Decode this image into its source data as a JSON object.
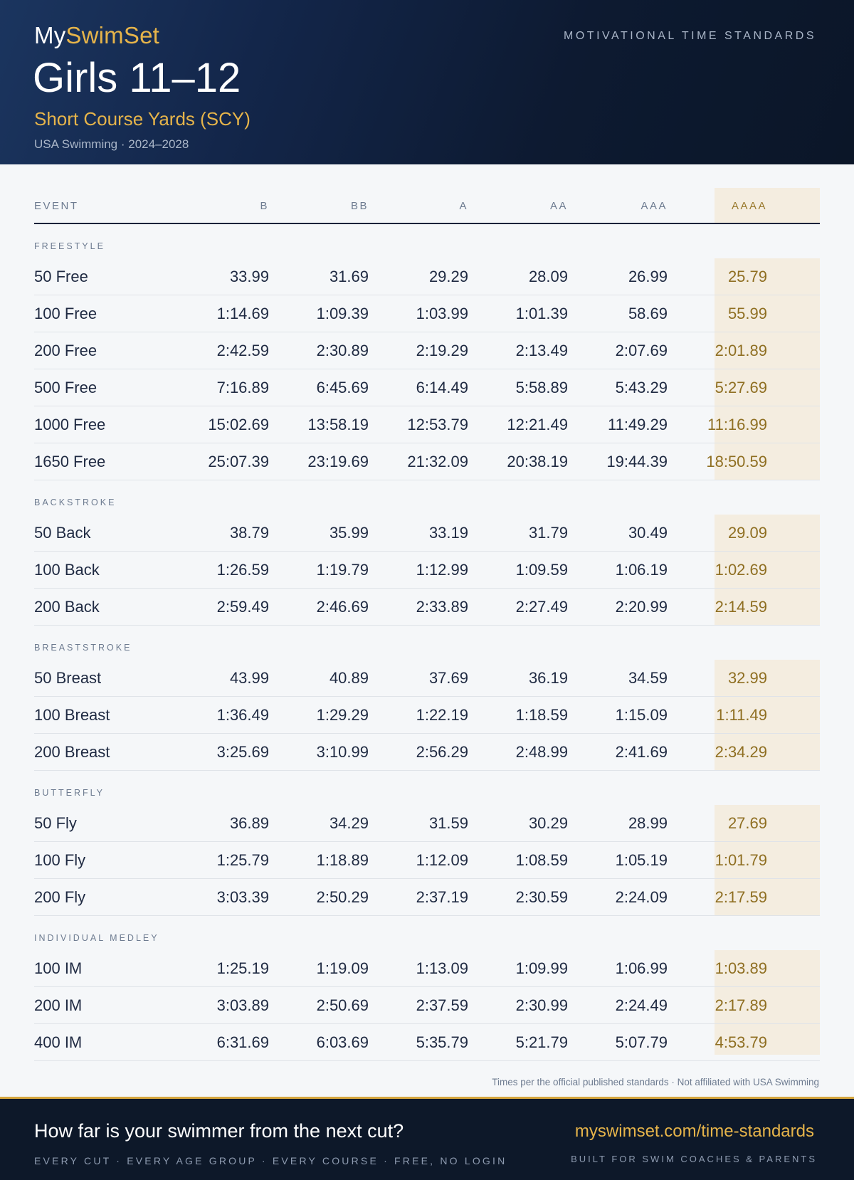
{
  "header": {
    "brand_prefix": "My",
    "brand_accent": "SwimSet",
    "kicker": "MOTIVATIONAL TIME STANDARDS",
    "title": "Girls 11–12",
    "subtitle": "Short Course Yards (SCY)",
    "meta": "USA Swimming · 2024–2028"
  },
  "table": {
    "columns": [
      "EVENT",
      "B",
      "BB",
      "A",
      "AA",
      "AAA",
      "AAAA"
    ],
    "highlight_color": "#f4ede0",
    "sections": [
      {
        "name": "FREESTYLE",
        "rows": [
          {
            "event": "50 Free",
            "times": [
              "33.99",
              "31.69",
              "29.29",
              "28.09",
              "26.99",
              "25.79"
            ]
          },
          {
            "event": "100 Free",
            "times": [
              "1:14.69",
              "1:09.39",
              "1:03.99",
              "1:01.39",
              "58.69",
              "55.99"
            ]
          },
          {
            "event": "200 Free",
            "times": [
              "2:42.59",
              "2:30.89",
              "2:19.29",
              "2:13.49",
              "2:07.69",
              "2:01.89"
            ]
          },
          {
            "event": "500 Free",
            "times": [
              "7:16.89",
              "6:45.69",
              "6:14.49",
              "5:58.89",
              "5:43.29",
              "5:27.69"
            ]
          },
          {
            "event": "1000 Free",
            "times": [
              "15:02.69",
              "13:58.19",
              "12:53.79",
              "12:21.49",
              "11:49.29",
              "11:16.99"
            ]
          },
          {
            "event": "1650 Free",
            "times": [
              "25:07.39",
              "23:19.69",
              "21:32.09",
              "20:38.19",
              "19:44.39",
              "18:50.59"
            ]
          }
        ]
      },
      {
        "name": "BACKSTROKE",
        "rows": [
          {
            "event": "50 Back",
            "times": [
              "38.79",
              "35.99",
              "33.19",
              "31.79",
              "30.49",
              "29.09"
            ]
          },
          {
            "event": "100 Back",
            "times": [
              "1:26.59",
              "1:19.79",
              "1:12.99",
              "1:09.59",
              "1:06.19",
              "1:02.69"
            ]
          },
          {
            "event": "200 Back",
            "times": [
              "2:59.49",
              "2:46.69",
              "2:33.89",
              "2:27.49",
              "2:20.99",
              "2:14.59"
            ]
          }
        ]
      },
      {
        "name": "BREASTSTROKE",
        "rows": [
          {
            "event": "50 Breast",
            "times": [
              "43.99",
              "40.89",
              "37.69",
              "36.19",
              "34.59",
              "32.99"
            ]
          },
          {
            "event": "100 Breast",
            "times": [
              "1:36.49",
              "1:29.29",
              "1:22.19",
              "1:18.59",
              "1:15.09",
              "1:11.49"
            ]
          },
          {
            "event": "200 Breast",
            "times": [
              "3:25.69",
              "3:10.99",
              "2:56.29",
              "2:48.99",
              "2:41.69",
              "2:34.29"
            ]
          }
        ]
      },
      {
        "name": "BUTTERFLY",
        "rows": [
          {
            "event": "50 Fly",
            "times": [
              "36.89",
              "34.29",
              "31.59",
              "30.29",
              "28.99",
              "27.69"
            ]
          },
          {
            "event": "100 Fly",
            "times": [
              "1:25.79",
              "1:18.89",
              "1:12.09",
              "1:08.59",
              "1:05.19",
              "1:01.79"
            ]
          },
          {
            "event": "200 Fly",
            "times": [
              "3:03.39",
              "2:50.29",
              "2:37.19",
              "2:30.59",
              "2:24.09",
              "2:17.59"
            ]
          }
        ]
      },
      {
        "name": "INDIVIDUAL MEDLEY",
        "rows": [
          {
            "event": "100 IM",
            "times": [
              "1:25.19",
              "1:19.09",
              "1:13.09",
              "1:09.99",
              "1:06.99",
              "1:03.89"
            ]
          },
          {
            "event": "200 IM",
            "times": [
              "3:03.89",
              "2:50.69",
              "2:37.59",
              "2:30.99",
              "2:24.49",
              "2:17.89"
            ]
          },
          {
            "event": "400 IM",
            "times": [
              "6:31.69",
              "6:03.69",
              "5:35.79",
              "5:21.79",
              "5:07.79",
              "4:53.79"
            ]
          }
        ]
      }
    ]
  },
  "footnote": "Times per the official published standards · Not affiliated with USA Swimming",
  "footer": {
    "cta": "How far is your swimmer from the next cut?",
    "tagline": "EVERY CUT · EVERY AGE GROUP · EVERY COURSE · FREE, NO LOGIN",
    "url": "myswimset.com/time-standards",
    "built_for": "BUILT FOR SWIM COACHES & PARENTS"
  }
}
